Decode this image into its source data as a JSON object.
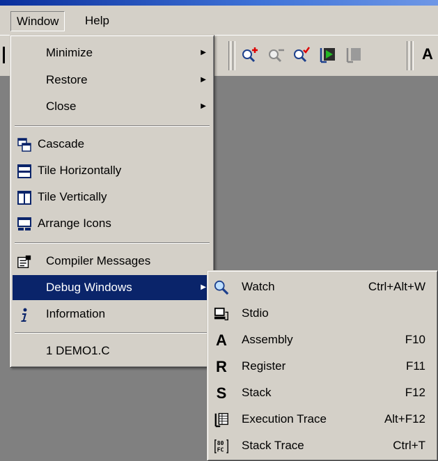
{
  "menubar": {
    "window": "Window",
    "help": "Help"
  },
  "window_menu": {
    "minimize": "Minimize",
    "restore": "Restore",
    "close": "Close",
    "cascade": "Cascade",
    "tile_horizontally": "Tile Horizontally",
    "tile_vertically": "Tile Vertically",
    "arrange_icons": "Arrange Icons",
    "compiler_messages": "Compiler Messages",
    "debug_windows": "Debug Windows",
    "information": "Information",
    "recent_file": "1 DEMO1.C"
  },
  "debug_submenu": {
    "watch": {
      "label": "Watch",
      "shortcut": "Ctrl+Alt+W"
    },
    "stdio": {
      "label": "Stdio",
      "shortcut": ""
    },
    "assembly": {
      "label": "Assembly",
      "shortcut": "F10",
      "glyph": "A"
    },
    "register": {
      "label": "Register",
      "shortcut": "F11",
      "glyph": "R"
    },
    "stack": {
      "label": "Stack",
      "shortcut": "F12",
      "glyph": "S"
    },
    "execution_trace": {
      "label": "Execution Trace",
      "shortcut": "Alt+F12"
    },
    "stack_trace": {
      "label": "Stack Trace",
      "shortcut": "Ctrl+T"
    }
  },
  "toolbar": {
    "trailing_glyph": "A"
  },
  "colors": {
    "menu_bg": "#d4d0c8",
    "highlight": "#0a246a",
    "workspace": "#808080"
  }
}
